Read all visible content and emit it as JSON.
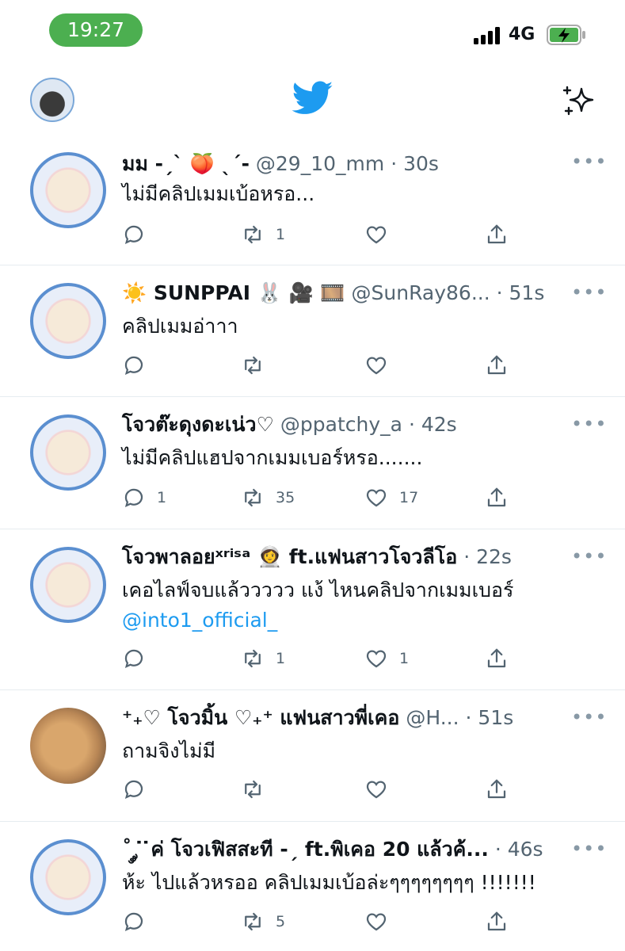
{
  "status_bar": {
    "time": "19:27",
    "network": "4G"
  },
  "icons": {
    "brand": "twitter-bird-icon",
    "top_right": "sparkle-icon",
    "reply": "reply-icon",
    "retweet": "retweet-icon",
    "like": "heart-icon",
    "share": "share-icon"
  },
  "colors": {
    "brand": "#1d9bf0",
    "time_pill": "#4caf50",
    "mention": "#1d9bf0"
  },
  "tweets": [
    {
      "name": "มม -ˏˋ 🍑 ˎˊ-",
      "handle": "@29_10_mm",
      "time": "30s",
      "text": "ไม่มีคลิปเมมเบ้อหรอ...",
      "mention": "",
      "reply_count": "",
      "retweet_count": "1",
      "like_count": ""
    },
    {
      "name": "☀️ SUNPPAI 🐰 🎥 🎞️",
      "handle": "@SunRay86...",
      "time": "51s",
      "text": "คลิปเมมอ่าาา",
      "mention": "",
      "reply_count": "",
      "retweet_count": "",
      "like_count": ""
    },
    {
      "name": "โจวต๊ะดุงดะเน่ว♡",
      "handle": "@ppatchy_a",
      "time": "42s",
      "text": "ไม่มีคลิปแฮปจากเมมเบอร์หรอ.......",
      "mention": "",
      "reply_count": "1",
      "retweet_count": "35",
      "like_count": "17"
    },
    {
      "name": "โจวพาลอยˣʳⁱˢᵃ 👩‍🚀 ft.แฟนสาวโจวลีโอ",
      "handle": "",
      "time": "22s",
      "text": "เคอไลฟ์จบแล้ววววว แง้ ไหนคลิปจากเมมเบอร์",
      "mention": "@into1_official_",
      "reply_count": "",
      "retweet_count": "1",
      "like_count": "1"
    },
    {
      "name": "⁺₊♡ โจวมิ้น ♡₊⁺ แฟนสาวพี่เคอ",
      "handle": "@H...",
      "time": "51s",
      "text": "ถามจิงไม่มี",
      "mention": "",
      "reply_count": "",
      "retweet_count": "",
      "like_count": ""
    },
    {
      "name": "˚ ༘ ̇ ̇ค่ โจวเฟิสสะที -ˏ ft.พิเคอ 20 แล้วค้...",
      "handle": "",
      "time": "46s",
      "text": "ห้ะ ไปแล้วหรออ คลิปเมมเบ้อล่ะๆๆๆๆๆๆๆๆ !!!!!!!",
      "mention": "",
      "reply_count": "",
      "retweet_count": "5",
      "like_count": ""
    }
  ]
}
